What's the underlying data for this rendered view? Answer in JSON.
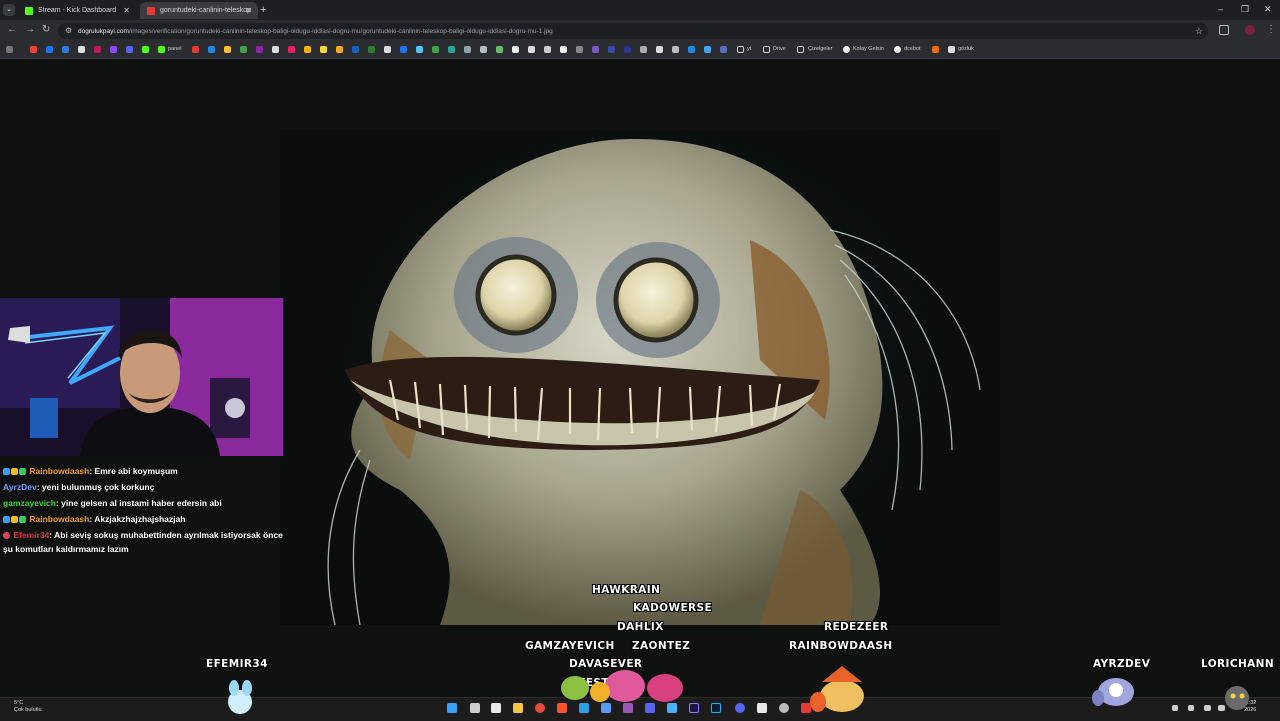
{
  "browser": {
    "tabs": [
      {
        "title": "Stream - Kick Dashboard",
        "icon": "kick-icon",
        "active": false
      },
      {
        "title": "goruntudeki-canlinin-teleskop",
        "icon": "dogruluk-payi-icon",
        "active": true
      }
    ],
    "new_tab_icon": "plus-icon",
    "url_host": "dogrulukpayi.com",
    "url_path": "/images/verification/goruntudeki-canlinin-teleskop-baligi-oldugu-iddiasi-dogru-mu/goruntudeki-canlinin-teleskop-baligi-oldugu-iddiasi-dogru-mu-1.jpg",
    "bookmarks": [
      "panel",
      "yt",
      "Drive",
      "Çizelgeler",
      "Kolay Gelsin",
      "dcebot",
      "gözlük"
    ]
  },
  "chat": [
    {
      "user": "Rainbowdaash",
      "text": ": Emre abi koymuşum",
      "color": "#f0a020",
      "badges": [
        "#3ba0ff",
        "#f0c020",
        "#33cc66"
      ]
    },
    {
      "user": "AyrzDev",
      "text": ": yeni bulunmuş çok korkunç",
      "color": "#6f9fff",
      "badges": []
    },
    {
      "user": "gamzayevich",
      "text": ": yine gelsen al instami haber edersin abi",
      "color": "#3ed33e",
      "badges": []
    },
    {
      "user": "Rainbowdaash",
      "text": ": Akzjakzhajzhajshazjah",
      "color": "#f0a020",
      "badges": [
        "#3ba0ff",
        "#f0c020",
        "#33cc66"
      ]
    },
    {
      "user": "Efemir34",
      "text": ": Abi seviş sokuş muhabettinden ayrılmak istiyorsak önce şu komutları kaldırmamız lazım",
      "color": "#e0303a",
      "badges": [
        "#e04060"
      ]
    }
  ],
  "overlay_names": [
    "HAWKRAIN",
    "KADOWERSE",
    "DAHLIX",
    "REDEZEER",
    "GAMZAYEVICH",
    "ZAONTEZ",
    "RAINBOWDAASH",
    "EFEMIR34",
    "DAVASEVER",
    "IKESTIAA",
    "AYRZDEV",
    "LORICHANN"
  ],
  "taskbar": {
    "weather_temp": "5°C",
    "weather_desc": "Çok bulutlu",
    "time": "11:32",
    "date": "2026"
  }
}
